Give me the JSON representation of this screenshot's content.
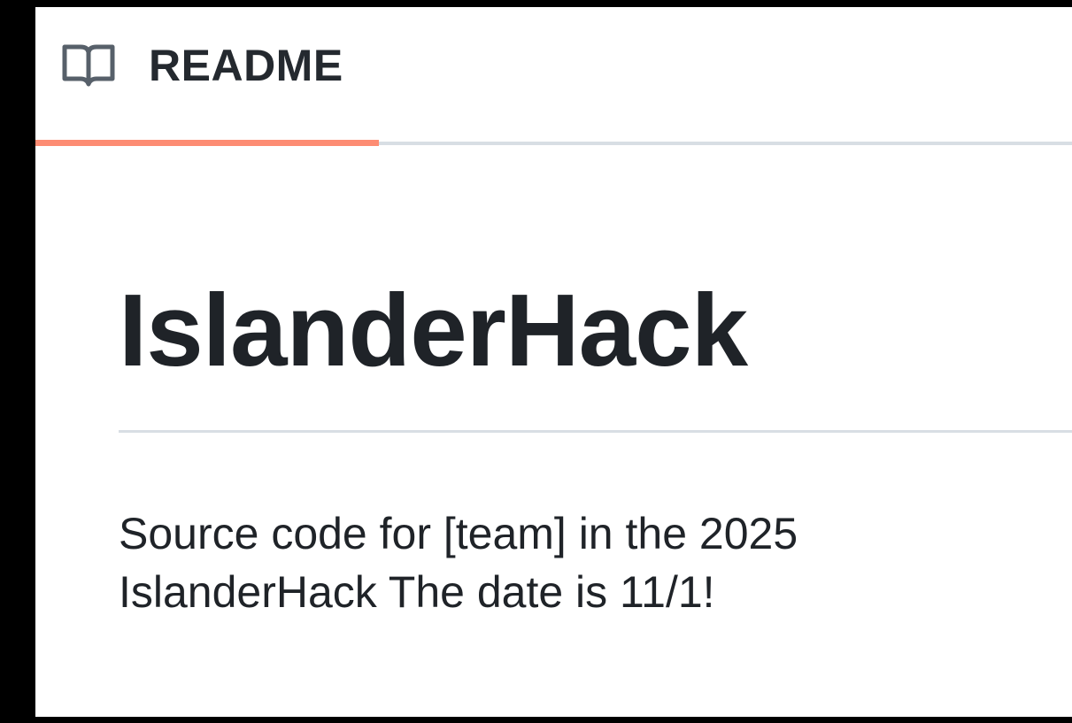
{
  "tab": {
    "icon": "book-icon",
    "label": "README"
  },
  "readme": {
    "title": "IslanderHack",
    "paragraph_line1": "Source code for [team] in the 2025",
    "paragraph_line2": "IslanderHack The date is 11/1!"
  },
  "colors": {
    "active_tab_underline": "#fd8c73",
    "divider": "#d8dee4",
    "text": "#1f2328",
    "frame_border": "#000000"
  }
}
